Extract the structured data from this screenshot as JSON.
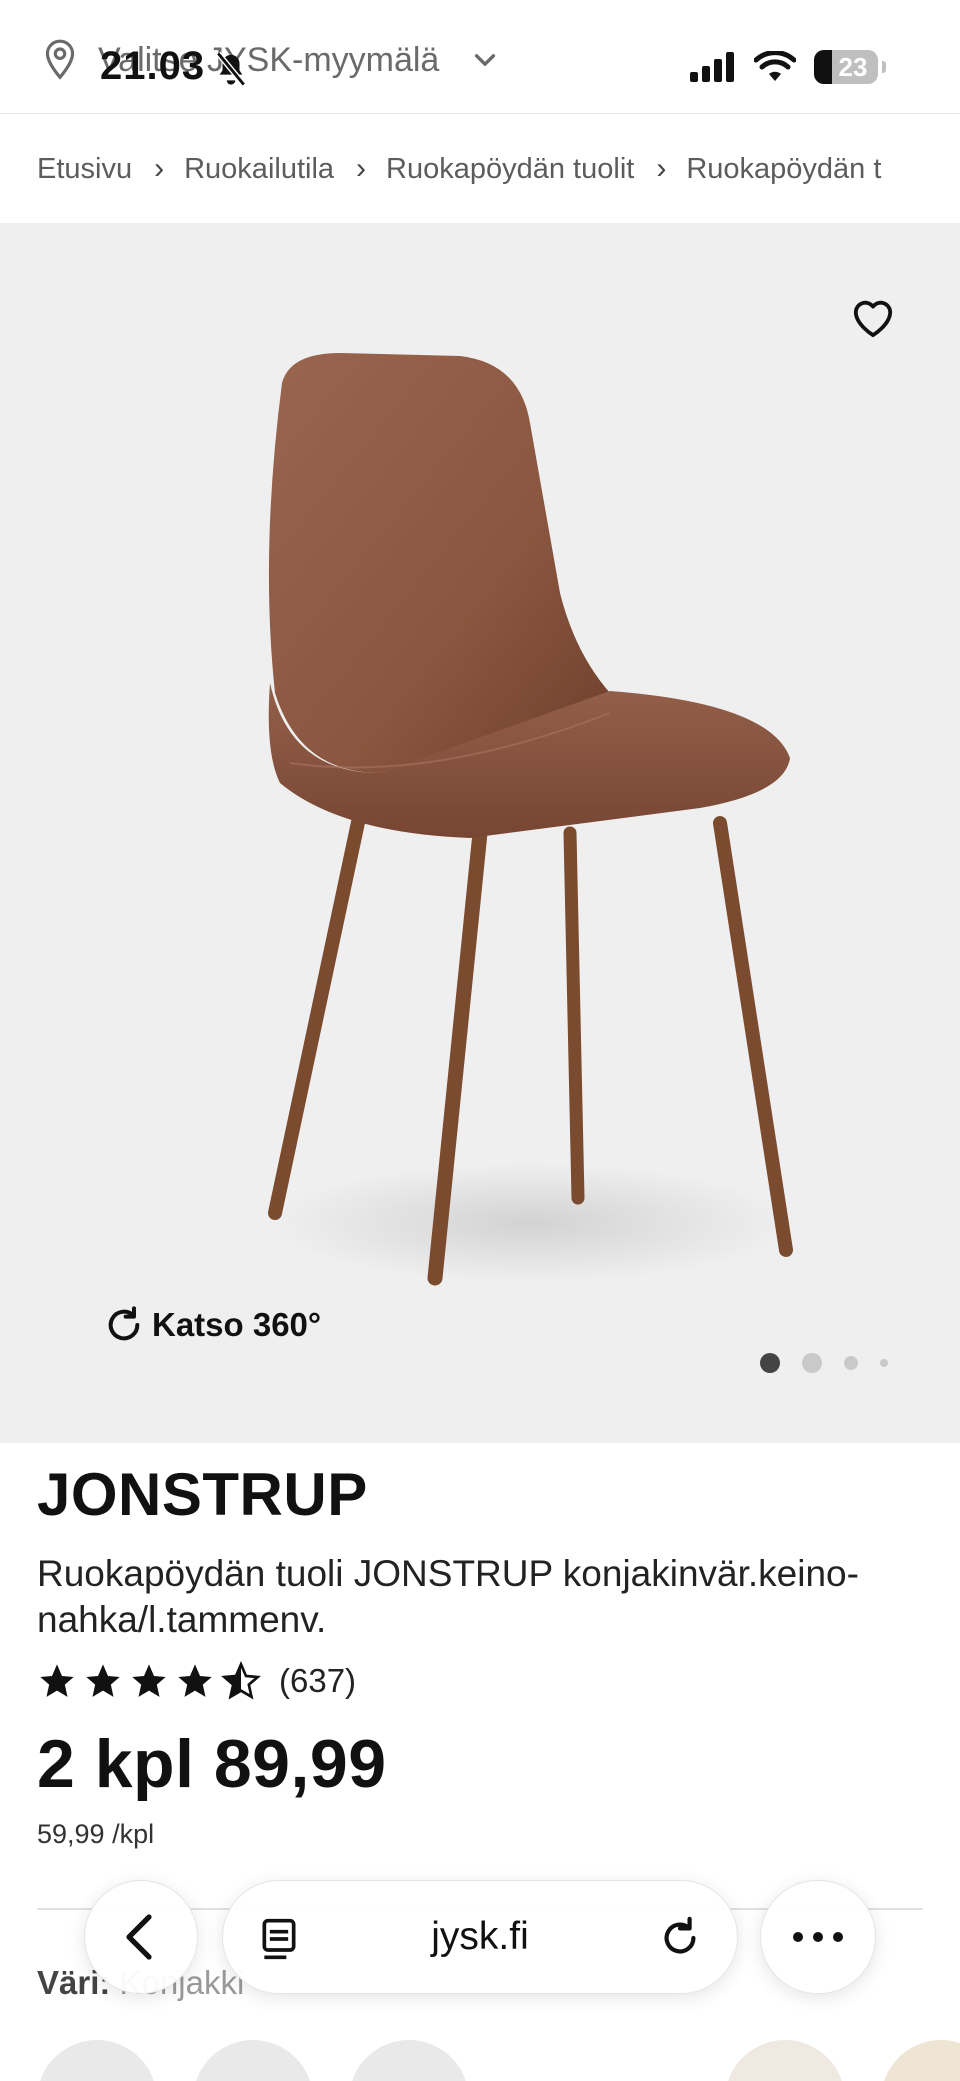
{
  "status_bar": {
    "time": "21.03",
    "battery": "23"
  },
  "store_bar": {
    "label": "Valitse JYSK-myymälä"
  },
  "breadcrumb": {
    "items": [
      "Etusivu",
      "Ruokailutila",
      "Ruokapöydän tuolit",
      "Ruokapöydän t"
    ]
  },
  "gallery": {
    "view_360_label": "Katso 360°",
    "pages": 4,
    "active_page": 1
  },
  "product": {
    "name": "JONSTRUP",
    "description": "Ruokapöydän tuoli JONSTRUP konjakinvär.keino-nahka/l.tammenv.",
    "rating": 4.5,
    "review_count": "(637)",
    "price": "2 kpl 89,99",
    "unit_price": "59,99 /kpl"
  },
  "variant": {
    "label": "Väri:",
    "value": "Konjakki"
  },
  "browser": {
    "url": "jysk.fi"
  },
  "colors": {
    "text": "#111111",
    "muted": "#5c5c5c",
    "image_bg": "#f0efef",
    "chair": "#8e5a44",
    "legs": "#7a4b2e"
  }
}
